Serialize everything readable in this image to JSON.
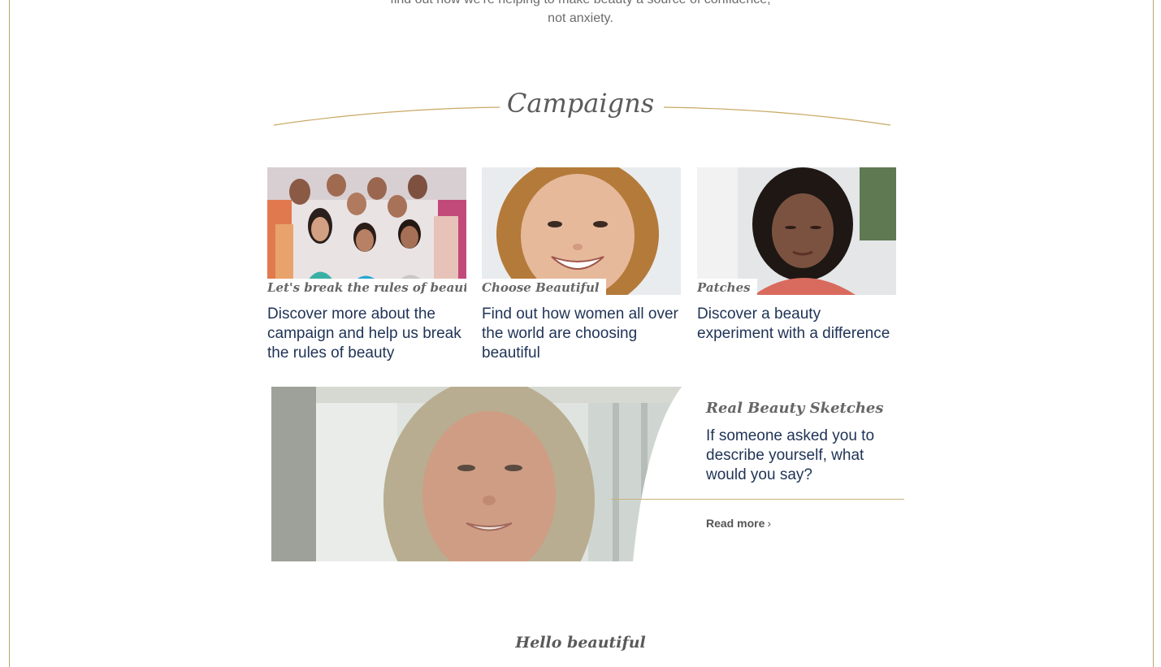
{
  "intro": {
    "line1": "find out how we're helping to make beauty a source of confidence,",
    "line2": "not anxiety."
  },
  "section": {
    "title": "Campaigns"
  },
  "cards": [
    {
      "tag": "Let's break the rules of beauty",
      "description": "Discover more about the campaign and help us break the rules of beauty",
      "image": "group-of-women-photo"
    },
    {
      "tag": "Choose Beautiful",
      "description": "Find out how women all over the world are choosing beautiful",
      "image": "smiling-woman-photo"
    },
    {
      "tag": "Patches",
      "description": "Discover a beauty experiment with a difference",
      "image": "woman-looking-down-photo"
    }
  ],
  "feature": {
    "title": "Real Beauty Sketches",
    "description": "If someone asked you to describe yourself, what would you say?",
    "read_more": "Read more",
    "chevron": "›",
    "image": "smiling-blonde-woman-photo"
  },
  "footer_heading": "Hello beautiful",
  "colors": {
    "accent_line": "#c8b27a",
    "frame": "#b8a56a",
    "link_text": "#1f3356"
  }
}
